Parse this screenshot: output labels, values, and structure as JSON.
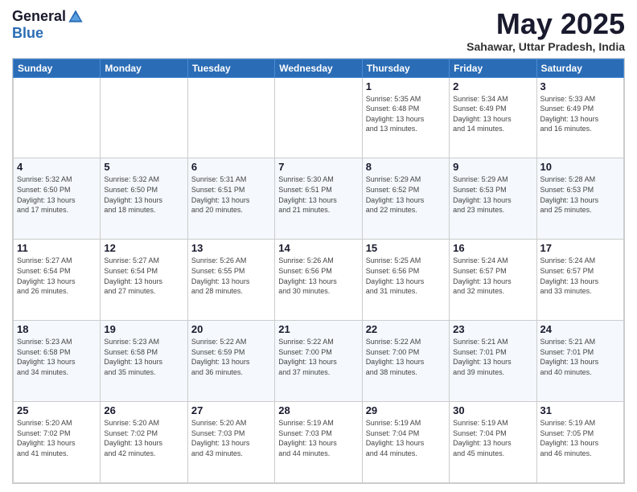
{
  "logo": {
    "general": "General",
    "blue": "Blue"
  },
  "title": "May 2025",
  "subtitle": "Sahawar, Uttar Pradesh, India",
  "days_of_week": [
    "Sunday",
    "Monday",
    "Tuesday",
    "Wednesday",
    "Thursday",
    "Friday",
    "Saturday"
  ],
  "weeks": [
    [
      {
        "day": "",
        "info": ""
      },
      {
        "day": "",
        "info": ""
      },
      {
        "day": "",
        "info": ""
      },
      {
        "day": "",
        "info": ""
      },
      {
        "day": "1",
        "info": "Sunrise: 5:35 AM\nSunset: 6:48 PM\nDaylight: 13 hours\nand 13 minutes."
      },
      {
        "day": "2",
        "info": "Sunrise: 5:34 AM\nSunset: 6:49 PM\nDaylight: 13 hours\nand 14 minutes."
      },
      {
        "day": "3",
        "info": "Sunrise: 5:33 AM\nSunset: 6:49 PM\nDaylight: 13 hours\nand 16 minutes."
      }
    ],
    [
      {
        "day": "4",
        "info": "Sunrise: 5:32 AM\nSunset: 6:50 PM\nDaylight: 13 hours\nand 17 minutes."
      },
      {
        "day": "5",
        "info": "Sunrise: 5:32 AM\nSunset: 6:50 PM\nDaylight: 13 hours\nand 18 minutes."
      },
      {
        "day": "6",
        "info": "Sunrise: 5:31 AM\nSunset: 6:51 PM\nDaylight: 13 hours\nand 20 minutes."
      },
      {
        "day": "7",
        "info": "Sunrise: 5:30 AM\nSunset: 6:51 PM\nDaylight: 13 hours\nand 21 minutes."
      },
      {
        "day": "8",
        "info": "Sunrise: 5:29 AM\nSunset: 6:52 PM\nDaylight: 13 hours\nand 22 minutes."
      },
      {
        "day": "9",
        "info": "Sunrise: 5:29 AM\nSunset: 6:53 PM\nDaylight: 13 hours\nand 23 minutes."
      },
      {
        "day": "10",
        "info": "Sunrise: 5:28 AM\nSunset: 6:53 PM\nDaylight: 13 hours\nand 25 minutes."
      }
    ],
    [
      {
        "day": "11",
        "info": "Sunrise: 5:27 AM\nSunset: 6:54 PM\nDaylight: 13 hours\nand 26 minutes."
      },
      {
        "day": "12",
        "info": "Sunrise: 5:27 AM\nSunset: 6:54 PM\nDaylight: 13 hours\nand 27 minutes."
      },
      {
        "day": "13",
        "info": "Sunrise: 5:26 AM\nSunset: 6:55 PM\nDaylight: 13 hours\nand 28 minutes."
      },
      {
        "day": "14",
        "info": "Sunrise: 5:26 AM\nSunset: 6:56 PM\nDaylight: 13 hours\nand 30 minutes."
      },
      {
        "day": "15",
        "info": "Sunrise: 5:25 AM\nSunset: 6:56 PM\nDaylight: 13 hours\nand 31 minutes."
      },
      {
        "day": "16",
        "info": "Sunrise: 5:24 AM\nSunset: 6:57 PM\nDaylight: 13 hours\nand 32 minutes."
      },
      {
        "day": "17",
        "info": "Sunrise: 5:24 AM\nSunset: 6:57 PM\nDaylight: 13 hours\nand 33 minutes."
      }
    ],
    [
      {
        "day": "18",
        "info": "Sunrise: 5:23 AM\nSunset: 6:58 PM\nDaylight: 13 hours\nand 34 minutes."
      },
      {
        "day": "19",
        "info": "Sunrise: 5:23 AM\nSunset: 6:58 PM\nDaylight: 13 hours\nand 35 minutes."
      },
      {
        "day": "20",
        "info": "Sunrise: 5:22 AM\nSunset: 6:59 PM\nDaylight: 13 hours\nand 36 minutes."
      },
      {
        "day": "21",
        "info": "Sunrise: 5:22 AM\nSunset: 7:00 PM\nDaylight: 13 hours\nand 37 minutes."
      },
      {
        "day": "22",
        "info": "Sunrise: 5:22 AM\nSunset: 7:00 PM\nDaylight: 13 hours\nand 38 minutes."
      },
      {
        "day": "23",
        "info": "Sunrise: 5:21 AM\nSunset: 7:01 PM\nDaylight: 13 hours\nand 39 minutes."
      },
      {
        "day": "24",
        "info": "Sunrise: 5:21 AM\nSunset: 7:01 PM\nDaylight: 13 hours\nand 40 minutes."
      }
    ],
    [
      {
        "day": "25",
        "info": "Sunrise: 5:20 AM\nSunset: 7:02 PM\nDaylight: 13 hours\nand 41 minutes."
      },
      {
        "day": "26",
        "info": "Sunrise: 5:20 AM\nSunset: 7:02 PM\nDaylight: 13 hours\nand 42 minutes."
      },
      {
        "day": "27",
        "info": "Sunrise: 5:20 AM\nSunset: 7:03 PM\nDaylight: 13 hours\nand 43 minutes."
      },
      {
        "day": "28",
        "info": "Sunrise: 5:19 AM\nSunset: 7:03 PM\nDaylight: 13 hours\nand 44 minutes."
      },
      {
        "day": "29",
        "info": "Sunrise: 5:19 AM\nSunset: 7:04 PM\nDaylight: 13 hours\nand 44 minutes."
      },
      {
        "day": "30",
        "info": "Sunrise: 5:19 AM\nSunset: 7:04 PM\nDaylight: 13 hours\nand 45 minutes."
      },
      {
        "day": "31",
        "info": "Sunrise: 5:19 AM\nSunset: 7:05 PM\nDaylight: 13 hours\nand 46 minutes."
      }
    ]
  ]
}
